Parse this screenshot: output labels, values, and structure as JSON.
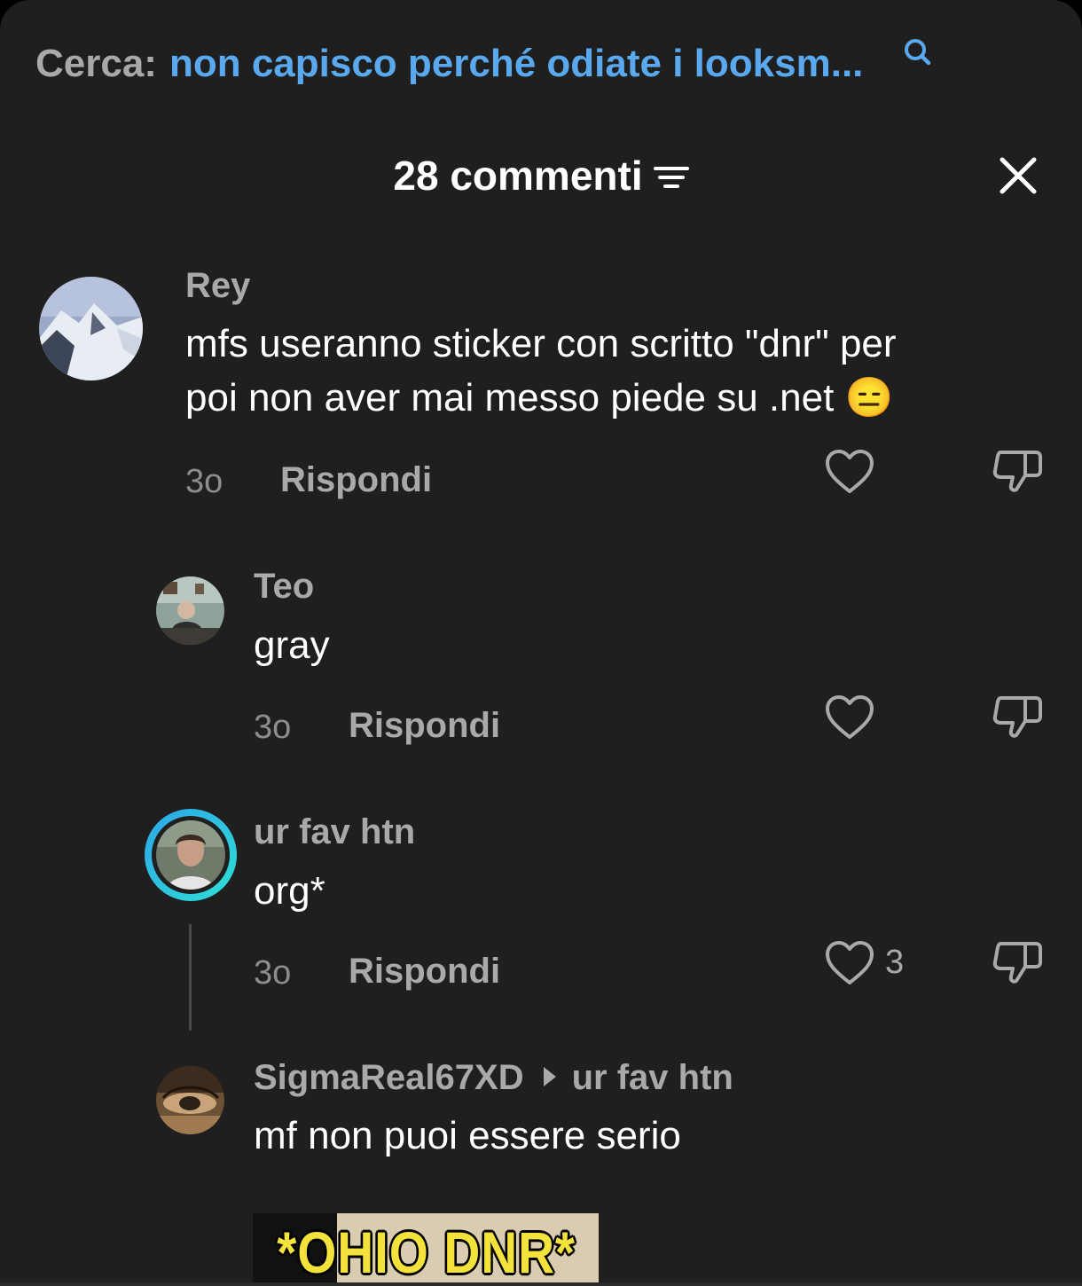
{
  "search": {
    "prefix": "Cerca:",
    "query": "non capisco perché odiate i looksm..."
  },
  "header": {
    "title": "28 commenti"
  },
  "colors": {
    "background": "#1f1f1f",
    "search_accent": "#5aa8ee",
    "story_ring": "#2ec9e3"
  },
  "comments": [
    {
      "user": "Rey",
      "text_lines": [
        "mfs useranno sticker con scritto \"dnr\" per",
        "poi non aver mai messo piede su .net 😑"
      ],
      "time": "3o",
      "reply_label": "Rispondi"
    },
    {
      "user": "Teo",
      "text": "gray",
      "time": "3o",
      "reply_label": "Rispondi"
    },
    {
      "user": "ur fav htn",
      "text": "org*",
      "time": "3o",
      "reply_label": "Rispondi",
      "likes": "3"
    },
    {
      "user": "SigmaReal67XD",
      "reply_to": "ur fav htn",
      "text": "mf non puoi essere serio",
      "sticker_text": "*OHIO DNR*"
    }
  ]
}
